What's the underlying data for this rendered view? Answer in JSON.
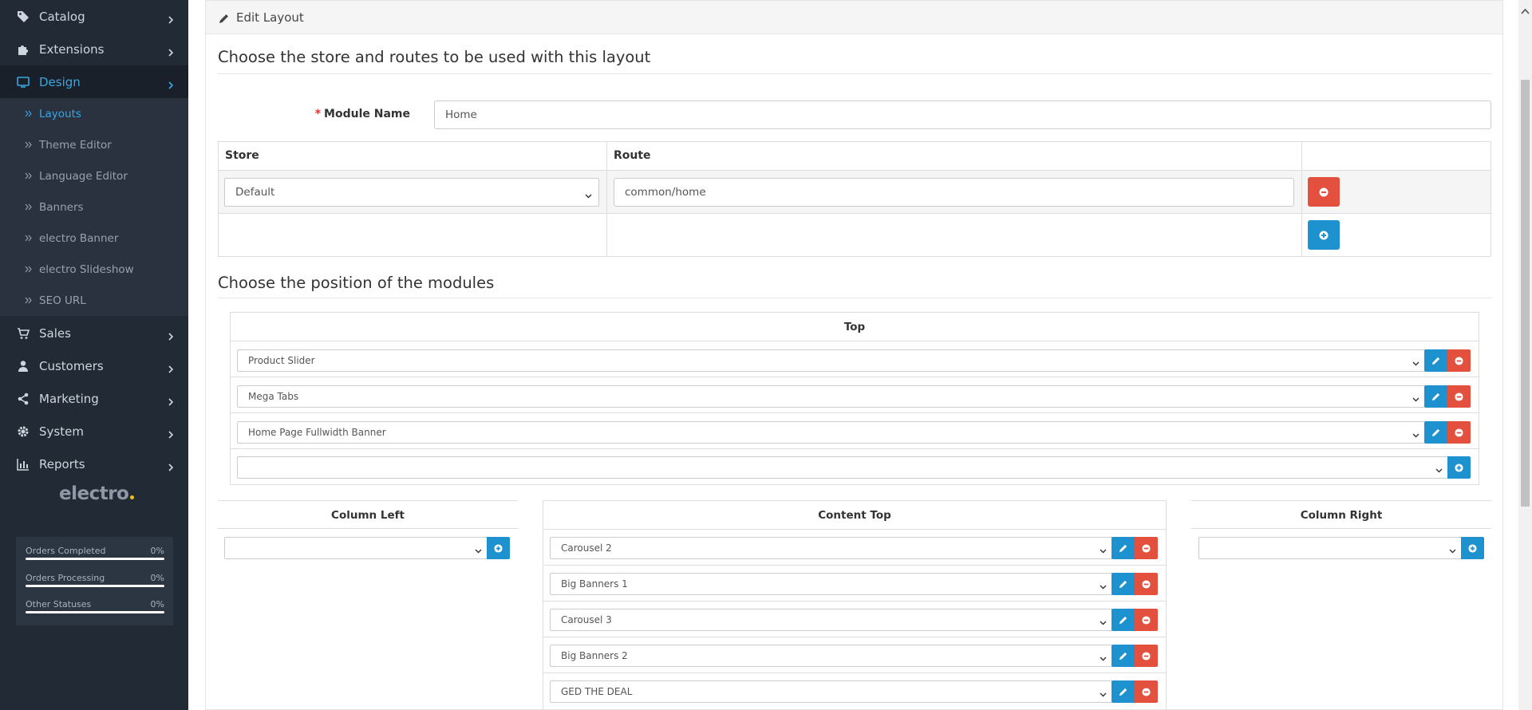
{
  "sidebar": {
    "items": [
      {
        "label": "Catalog",
        "icon": "tags-icon"
      },
      {
        "label": "Extensions",
        "icon": "puzzle-icon"
      },
      {
        "label": "Design",
        "icon": "monitor-icon"
      },
      {
        "label": "Sales",
        "icon": "cart-icon"
      },
      {
        "label": "Customers",
        "icon": "user-icon"
      },
      {
        "label": "Marketing",
        "icon": "share-icon"
      },
      {
        "label": "System",
        "icon": "gear-icon"
      },
      {
        "label": "Reports",
        "icon": "bar-chart-icon"
      }
    ],
    "active_item": "Design",
    "design_children": [
      "Layouts",
      "Theme Editor",
      "Language Editor",
      "Banners",
      "electro Banner",
      "electro Slideshow",
      "SEO URL"
    ],
    "active_child": "Layouts",
    "brand": "electro",
    "stats": [
      {
        "label": "Orders Completed",
        "value": "0%",
        "fraction": 0
      },
      {
        "label": "Orders Processing",
        "value": "0%",
        "fraction": 0
      },
      {
        "label": "Other Statuses",
        "value": "0%",
        "fraction": 0
      }
    ]
  },
  "panel": {
    "title": "Edit Layout",
    "section_store_routes": "Choose the store and routes to be used with this layout",
    "module_name_label": "Module Name",
    "required_mark": "*",
    "module_name_value": "Home",
    "table_headers": {
      "store": "Store",
      "route": "Route"
    },
    "route_row": {
      "store": "Default",
      "route": "common/home"
    },
    "section_positions": "Choose the position of the modules"
  },
  "positions": {
    "top": {
      "label": "Top",
      "modules": [
        "Product Slider",
        "Mega Tabs",
        "Home Page Fullwidth Banner"
      ]
    },
    "column_left": {
      "label": "Column Left"
    },
    "content_top": {
      "label": "Content Top",
      "modules": [
        "Carousel 2",
        "Big Banners 1",
        "Carousel 3",
        "Big Banners 2",
        "GED THE DEAL"
      ]
    },
    "column_right": {
      "label": "Column Right"
    }
  },
  "colors": {
    "sidebar_bg": "#222a35",
    "accent": "#1e91cf",
    "danger": "#e3503e",
    "active_text": "#3aa7e3"
  }
}
